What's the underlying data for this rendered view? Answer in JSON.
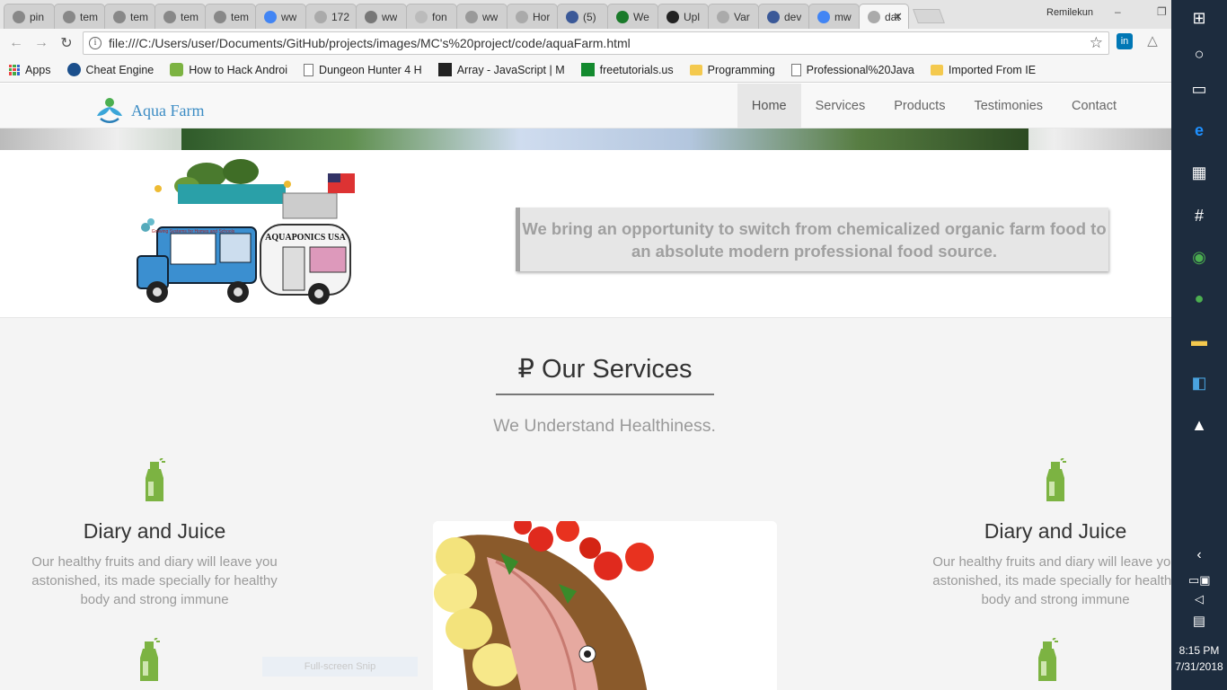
{
  "browser": {
    "tabs": [
      {
        "title": "pin",
        "color": "#888"
      },
      {
        "title": "tem",
        "color": "#888"
      },
      {
        "title": "tem",
        "color": "#888"
      },
      {
        "title": "tem",
        "color": "#888"
      },
      {
        "title": "tem",
        "color": "#888"
      },
      {
        "title": "ww",
        "color": "#4285f4"
      },
      {
        "title": "172",
        "color": "#aaa"
      },
      {
        "title": "ww",
        "color": "#777"
      },
      {
        "title": "fon",
        "color": "#bbb"
      },
      {
        "title": "ww",
        "color": "#999"
      },
      {
        "title": "Hor",
        "color": "#aaa"
      },
      {
        "title": "(5)",
        "color": "#3b5998"
      },
      {
        "title": "We",
        "color": "#1a7a2a"
      },
      {
        "title": "Upl",
        "color": "#222"
      },
      {
        "title": "Var",
        "color": "#aaa"
      },
      {
        "title": "dev",
        "color": "#3b5998"
      },
      {
        "title": "mw",
        "color": "#4285f4"
      },
      {
        "title": "dat",
        "color": "#aaa"
      }
    ],
    "user_name": "Remilekun",
    "url": "file:///C:/Users/user/Documents/GitHub/projects/images/MC's%20project/code/aquaFarm.html",
    "bookmarks": [
      {
        "label": "Cheat Engine",
        "icon": "cheat-engine-icon"
      },
      {
        "label": "How to Hack Androi",
        "icon": "android-icon"
      },
      {
        "label": "Dungeon Hunter 4 H",
        "icon": "page-icon"
      },
      {
        "label": "Array - JavaScript | M",
        "icon": "mdn-icon"
      },
      {
        "label": "freetutorials.us",
        "icon": "ftu-icon"
      },
      {
        "label": "Programming",
        "icon": "folder-icon"
      },
      {
        "label": "Professional%20Java",
        "icon": "page-icon"
      },
      {
        "label": "Imported From IE",
        "icon": "folder-icon"
      }
    ],
    "apps_label": "Apps"
  },
  "site": {
    "brand": "Aqua Farm",
    "menu": [
      "Home",
      "Services",
      "Products",
      "Testimonies",
      "Contact"
    ],
    "active_menu": "Home",
    "truck_sign": "AQUAPONICS USA",
    "truck_side": "Growing Systems for Homes and Schools",
    "quote": "We bring an opportunity to switch from chemicalized organic farm food to an absolute modern professional food source.",
    "services_title": "Our Services",
    "services_icon": "₽",
    "services_sub": "We Understand Healthiness.",
    "service_left": {
      "title": "Diary and Juice",
      "text": "Our healthy fruits and diary will leave you astonished, its made specially for healthy body and strong immune"
    },
    "service_right": {
      "title": "Diary and Juice",
      "text": "Our healthy fruits and diary will leave you astonished, its made specially for healthy body and strong immune"
    },
    "snip_label": "Full-screen Snip"
  },
  "taskbar": {
    "time": "8:15 PM",
    "date": "7/31/2018"
  },
  "colors": {
    "brand": "#3c8cc4",
    "bottle_green": "#7cb342",
    "taskbar": "#1d2c3e"
  }
}
